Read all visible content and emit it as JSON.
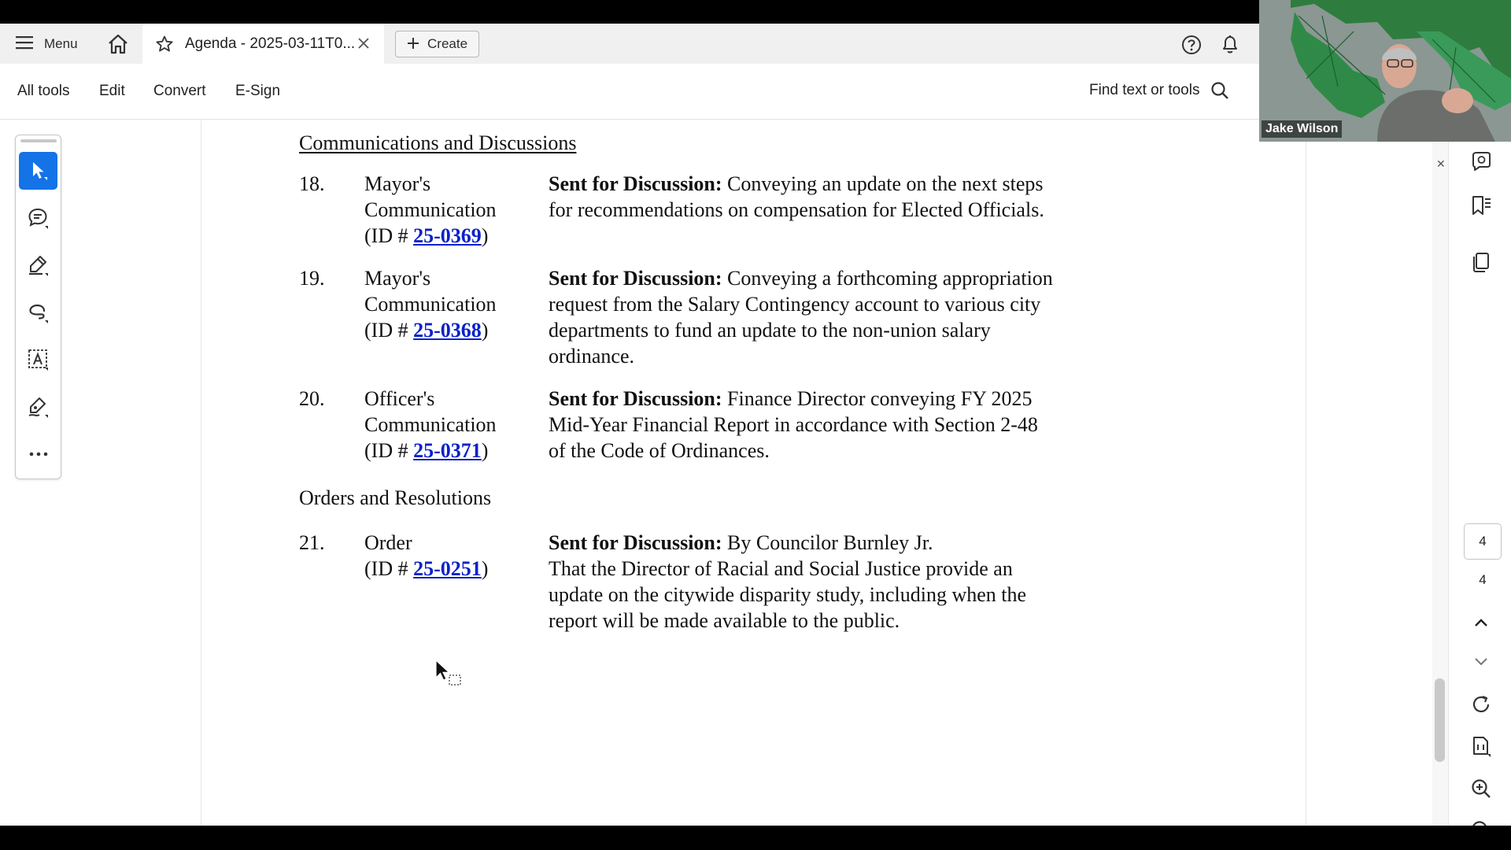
{
  "tabbar": {
    "menu_label": "Menu",
    "tab_title": "Agenda - 2025-03-11T0...",
    "create_label": "Create"
  },
  "toolbar": {
    "items": [
      "All tools",
      "Edit",
      "Convert",
      "E-Sign"
    ],
    "find_label": "Find text or tools"
  },
  "document": {
    "section1": "Communications and Discussions",
    "section2": "Orders and Resolutions",
    "items": [
      {
        "num": "18.",
        "type_line1": "Mayor's",
        "type_line2": "Communication",
        "id_prefix": "(ID # ",
        "id": "25-0369",
        "id_suffix": ")",
        "lead": "Sent for Discussion:",
        "text": " Conveying an update on the next steps for recommendations on compensation for Elected Officials."
      },
      {
        "num": "19.",
        "type_line1": "Mayor's",
        "type_line2": "Communication",
        "id_prefix": "(ID # ",
        "id": "25-0368",
        "id_suffix": ")",
        "lead": "Sent for Discussion:",
        "text": " Conveying a forthcoming appropriation request from the Salary Contingency account to various city departments to fund an update to the non-union salary ordinance."
      },
      {
        "num": "20.",
        "type_line1": "Officer's",
        "type_line2": "Communication",
        "id_prefix": "(ID # ",
        "id": "25-0371",
        "id_suffix": ")",
        "lead": "Sent for Discussion:",
        "text": " Finance Director conveying FY 2025 Mid-Year Financial Report in accordance with Section 2-48 of the Code of Ordinances."
      },
      {
        "num": "21.",
        "type_line1": "Order",
        "id_prefix": "(ID # ",
        "id": "25-0251",
        "id_suffix": ")",
        "lead": "Sent for Discussion:",
        "text": " By Councilor Burnley Jr.",
        "text2": "That the Director of Racial and Social Justice provide an update on the citywide disparity study, including when the report will be made available to the public."
      }
    ]
  },
  "page_nav": {
    "current": "4",
    "total": "4"
  },
  "video": {
    "participant_name": "Jake Wilson"
  },
  "icons": {
    "left_rail": [
      "select-icon",
      "comment-icon",
      "highlight-icon",
      "draw-icon",
      "text-box-icon",
      "sign-icon",
      "more-icon"
    ],
    "right_rail": [
      "ai-assistant-icon",
      "bookmarks-icon",
      "pages-icon",
      "chevron-up-icon",
      "chevron-down-icon",
      "rotate-icon",
      "fit-page-icon",
      "zoom-in-icon",
      "zoom-out-icon"
    ]
  },
  "colors": {
    "accent": "#1473e6",
    "link": "#0b21c9"
  }
}
